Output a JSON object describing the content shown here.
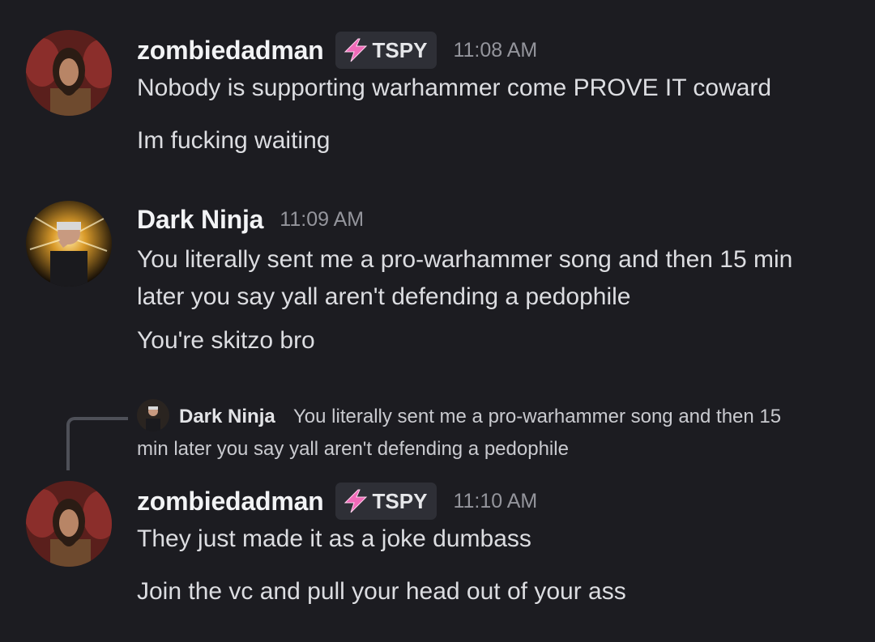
{
  "messages": [
    {
      "username": "zombiedadman",
      "tag": "TSPY",
      "tag_icon": "lightning-bolt-icon",
      "time": "11:08 AM",
      "lines": [
        "Nobody is supporting warhammer come PROVE IT coward",
        "Im fucking waiting"
      ]
    },
    {
      "username": "Dark Ninja",
      "time": "11:09 AM",
      "lines": [
        "You literally sent me a pro-warhammer song and then 15 min",
        "later you say yall aren't defending a pedophile",
        "You're skitzo bro"
      ]
    },
    {
      "reply": {
        "username": "Dark Ninja",
        "text_line1": "You literally sent me a pro-warhammer song and then 15",
        "text_line2": "min later you say yall aren't defending a pedophile"
      },
      "username": "zombiedadman",
      "tag": "TSPY",
      "tag_icon": "lightning-bolt-icon",
      "time": "11:10 AM",
      "lines": [
        "They just made it as a joke dumbass",
        "Join the vc and pull your head out of your ass"
      ]
    }
  ],
  "colors": {
    "background": "#1c1c21",
    "tag_bolt": "#f06ab8",
    "username": "#f2f3f5",
    "timestamp": "#94959c"
  }
}
